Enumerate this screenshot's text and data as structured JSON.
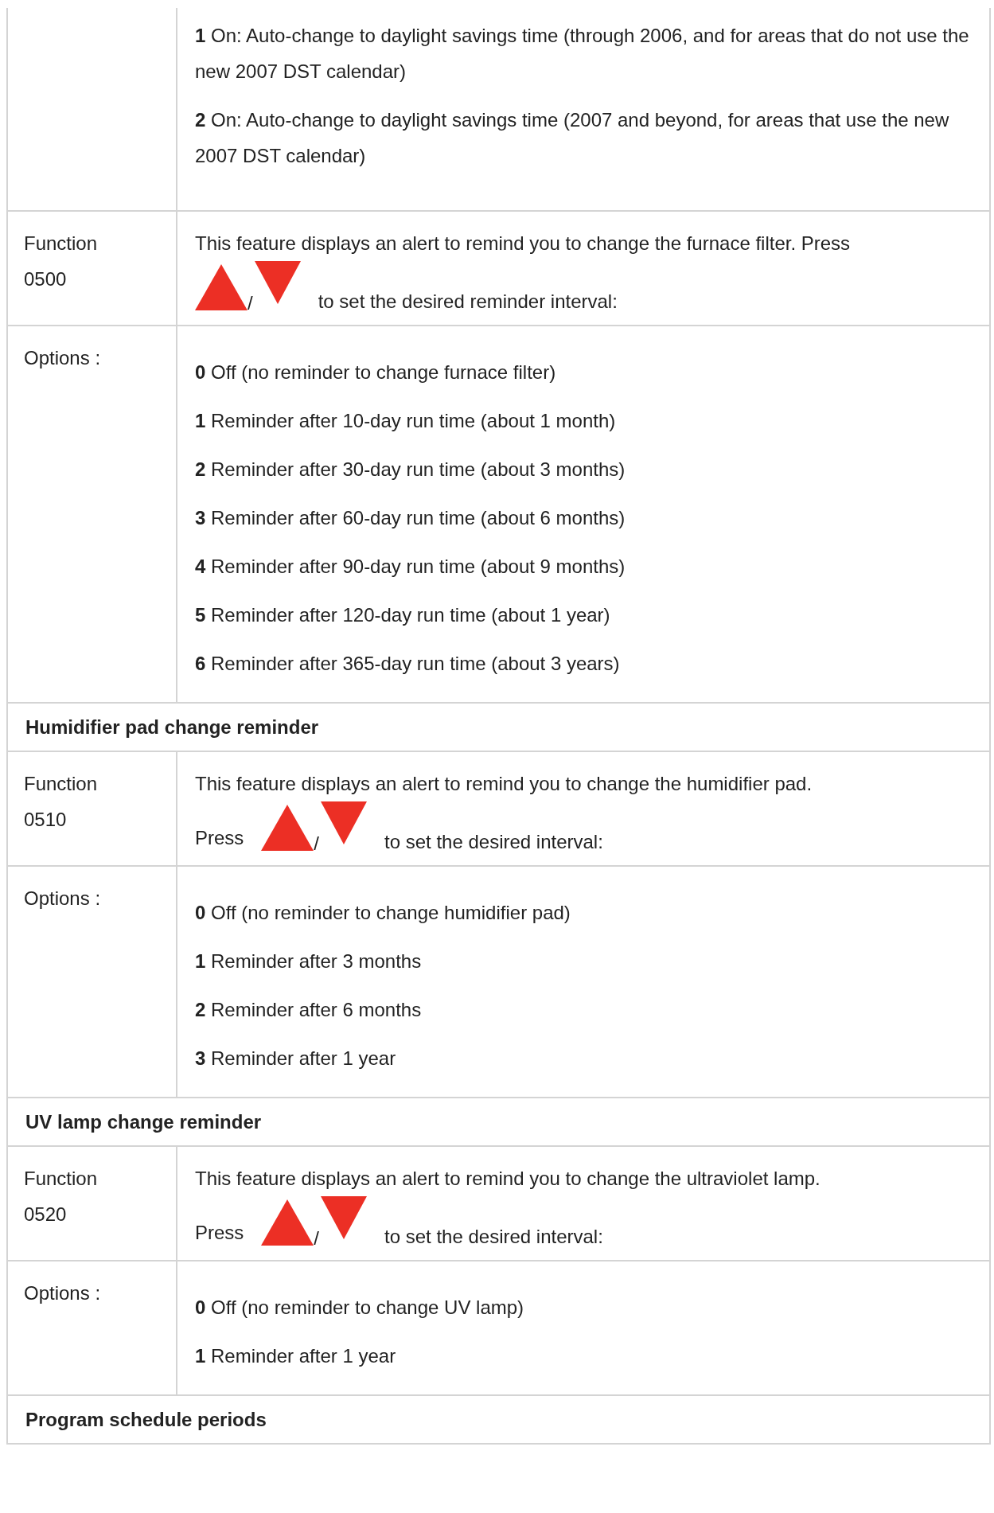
{
  "rows": [
    {
      "kind": "options",
      "items": [
        {
          "value": "1",
          "text": "On: Auto-change to daylight savings time (through 2006, and for areas that do not use the new 2007 DST calendar)"
        },
        {
          "value": "2",
          "text": "On: Auto-change to daylight savings time (2007 and beyond, for areas that use the new 2007 DST calendar)"
        }
      ]
    },
    {
      "kind": "function",
      "label": "Function",
      "code": "0500",
      "before": "This feature displays an alert to remind you to change the furnace filter. Press",
      "separator": "/",
      "after": "to set the desired reminder interval:"
    },
    {
      "kind": "options",
      "label": "Options :",
      "items": [
        {
          "value": "0",
          "text": "Off (no reminder to change furnace filter)"
        },
        {
          "value": "1",
          "text": "Reminder after 10-day run time (about 1 month)"
        },
        {
          "value": "2",
          "text": "Reminder after 30-day run time (about 3 months)"
        },
        {
          "value": "3",
          "text": "Reminder after 60-day run time (about 6 months)"
        },
        {
          "value": "4",
          "text": "Reminder after 90-day run time (about 9 months)"
        },
        {
          "value": "5",
          "text": "Reminder after 120-day run time (about 1 year)"
        },
        {
          "value": "6",
          "text": "Reminder after 365-day run time (about 3 years)"
        }
      ]
    },
    {
      "kind": "section",
      "title": "Humidifier pad change reminder"
    },
    {
      "kind": "function",
      "label": "Function",
      "code": "0510",
      "before": "This feature displays an alert to remind you to change the humidifier pad.",
      "prompt": "Press",
      "separator": "/",
      "after": "to set the desired interval:"
    },
    {
      "kind": "options",
      "label": "Options :",
      "items": [
        {
          "value": "0",
          "text": "Off (no reminder to change humidifier pad)"
        },
        {
          "value": "1",
          "text": "Reminder after 3 months"
        },
        {
          "value": "2",
          "text": "Reminder after 6 months"
        },
        {
          "value": "3",
          "text": "Reminder after 1 year"
        }
      ]
    },
    {
      "kind": "section",
      "title": "UV lamp change reminder"
    },
    {
      "kind": "function",
      "label": "Function",
      "code": "0520",
      "before": "This feature displays an alert to remind you to change the ultraviolet lamp.",
      "prompt": "Press",
      "separator": "/",
      "after": "to set the desired interval:"
    },
    {
      "kind": "options",
      "label": "Options :",
      "items": [
        {
          "value": "0",
          "text": "Off (no reminder to change UV lamp)"
        },
        {
          "value": "1",
          "text": "Reminder after 1 year"
        }
      ]
    },
    {
      "kind": "section",
      "title": "Program schedule periods"
    }
  ]
}
